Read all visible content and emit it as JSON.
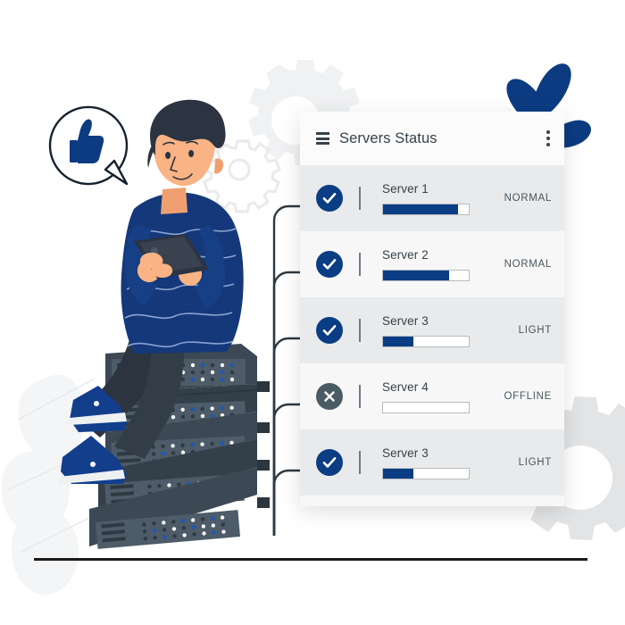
{
  "card": {
    "title": "Servers Status",
    "menu_icon": "hamburger-icon",
    "overflow_icon": "kebab-menu-icon",
    "accent_color": "#0b3d84",
    "offline_color": "#4b5b66",
    "rows": [
      {
        "name": "Server 1",
        "status": "NORMAL",
        "progress": 88,
        "state": "ok",
        "icon": "check-icon",
        "shade": "alt"
      },
      {
        "name": "Server 2",
        "status": "NORMAL",
        "progress": 77,
        "state": "ok",
        "icon": "check-icon",
        "shade": "base"
      },
      {
        "name": "Server 3",
        "status": "LIGHT",
        "progress": 35,
        "state": "ok",
        "icon": "check-icon",
        "shade": "alt"
      },
      {
        "name": "Server 4",
        "status": "OFFLINE",
        "progress": 0,
        "state": "offline",
        "icon": "close-icon",
        "shade": "base"
      },
      {
        "name": "Server 3",
        "status": "LIGHT",
        "progress": 35,
        "state": "ok",
        "icon": "check-icon",
        "shade": "alt"
      }
    ]
  },
  "illustration": {
    "character": "man-sitting-with-tablet",
    "speech_bubble_icon": "thumbs-up-icon",
    "server_rack": "server-rack-5-units",
    "decorations": [
      "gear-filled-top",
      "gear-outline-small",
      "gear-filled-bottom-right",
      "leaf-plant-blue",
      "leaf-plant-white"
    ],
    "colors": {
      "sweater": "#15387a",
      "skin": "#f9b384",
      "hair": "#2b3440",
      "rack": "#384450",
      "rack_panel": "#4a5864",
      "shoe": "#123e8c",
      "gear_light": "#f0f1f2",
      "leaf_blue": "#0c3b82",
      "leaf_white": "#f4f5f6",
      "ground": "#1a1a1a"
    }
  }
}
